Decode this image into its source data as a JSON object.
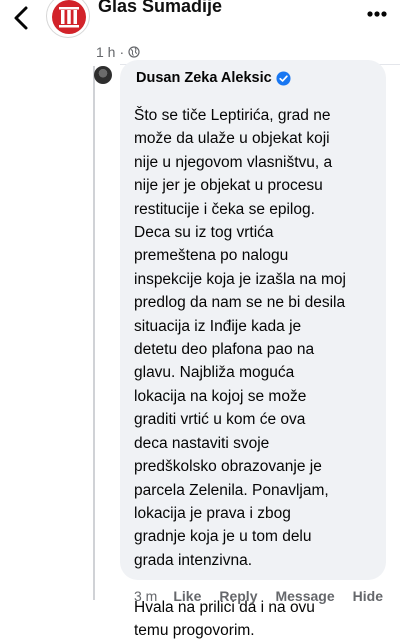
{
  "header": {
    "page_name": "Glas Šumadije",
    "time_ago": "1 h",
    "separator": "·",
    "audience_icon": "globe-icon",
    "back_icon": "chevron-left-icon",
    "more_icon": "more-options-icon",
    "logo_icon": "glas-sumadije-logo"
  },
  "comment": {
    "author": "Dusan Zeka Aleksic",
    "verified_icon": "verified-badge-icon",
    "avatar_icon": "commenter-avatar",
    "lines": [
      "Što se tiče Leptirića, grad ne",
      "može da ulaže u objekat koji",
      "nije u njegovom vlasništvu, a",
      "nije jer je objekat u procesu",
      "restitucije i čeka se epilog.",
      "Deca su iz tog vrtića",
      "premeštena po nalogu",
      "inspekcije koja je izašla na moj",
      "predlog da nam se ne bi desila",
      "situacija iz Inđije kada je",
      "detetu deo plafona pao na",
      "glavu. Najbliža moguća",
      "lokacija na kojoj se može",
      "graditi vrtić u kom će ova",
      "deca nastaviti svoje",
      "predškolsko obrazovanje je",
      "parcela Zelenila. Ponavljam,",
      "lokacija je prava i zbog",
      "gradnje koja je u tom delu",
      "grada intenzivna."
    ],
    "closing_lines": [
      "Hvala na prilici da i na ovu",
      "temu progovorim."
    ]
  },
  "actions": {
    "time": "3 m",
    "like": "Like",
    "reply": "Reply",
    "message": "Message",
    "hide": "Hide"
  },
  "colors": {
    "bubble": "#f0f2f5",
    "secondary_text": "#65676b",
    "verified": "#1877f2",
    "logo_red": "#d2232a"
  }
}
